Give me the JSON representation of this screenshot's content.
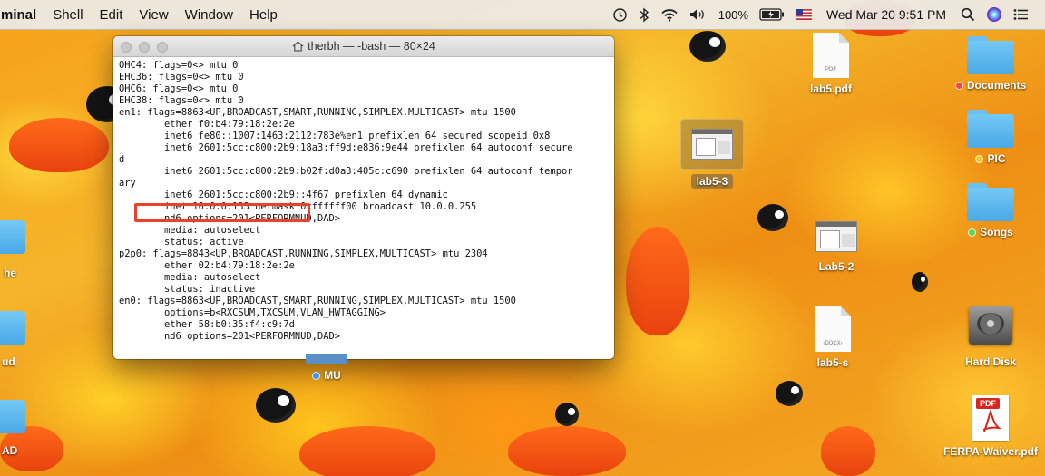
{
  "menubar": {
    "app_name": "minal",
    "items": [
      "Shell",
      "Edit",
      "View",
      "Window",
      "Help"
    ],
    "battery_percent": "100%",
    "clock": "Wed Mar 20  9:51 PM"
  },
  "terminal": {
    "title": "therbh — -bash — 80×24",
    "lines": [
      "OHC4: flags=0<> mtu 0",
      "EHC36: flags=0<> mtu 0",
      "OHC6: flags=0<> mtu 0",
      "EHC38: flags=0<> mtu 0",
      "en1: flags=8863<UP,BROADCAST,SMART,RUNNING,SIMPLEX,MULTICAST> mtu 1500",
      "        ether f0:b4:79:18:2e:2e",
      "        inet6 fe80::1007:1463:2112:783e%en1 prefixlen 64 secured scopeid 0x8",
      "        inet6 2601:5cc:c800:2b9:18a3:ff9d:e836:9e44 prefixlen 64 autoconf secure",
      "d",
      "        inet6 2601:5cc:c800:2b9:b02f:d0a3:405c:c690 prefixlen 64 autoconf tempor",
      "ary",
      "        inet6 2601:5cc:c800:2b9::4f67 prefixlen 64 dynamic",
      "        inet 10.0.0.133 netmask 0xffffff00 broadcast 10.0.0.255",
      "        nd6 options=201<PERFORMNUD,DAD>",
      "        media: autoselect",
      "        status: active",
      "p2p0: flags=8843<UP,BROADCAST,RUNNING,SIMPLEX,MULTICAST> mtu 2304",
      "        ether 02:b4:79:18:2e:2e",
      "        media: autoselect",
      "        status: inactive",
      "en0: flags=8863<UP,BROADCAST,SMART,RUNNING,SIMPLEX,MULTICAST> mtu 1500",
      "        options=b<RXCSUM,TXCSUM,VLAN_HWTAGGING>",
      "        ether 58:b0:35:f4:c9:7d",
      "        nd6 options=201<PERFORMNUD,DAD>"
    ]
  },
  "desktop": {
    "lab5_pdf": "lab5.pdf",
    "lab5_pdf_doc_text": "PDF",
    "lab5_3": "lab5-3",
    "lab5_2": "Lab5-2",
    "lab5_s": "lab5-s",
    "lab5_s_doc_text": "‹DOCX›",
    "documents": "Documents",
    "pic": "PIC",
    "songs": "Songs",
    "hard_disk": "Hard Disk",
    "ferpa": "FERPA-Waiver.pdf",
    "ferpa_badge": "PDF",
    "mu": "MU",
    "left_edge_labels": [
      "he",
      "ud",
      "AD"
    ]
  },
  "colors": {
    "documents_tag": "#f0494a",
    "pic_tag": "#f6c829",
    "songs_tag": "#5fd35c",
    "mu_tag": "#3d94f5",
    "highlight": "#e8432a"
  }
}
